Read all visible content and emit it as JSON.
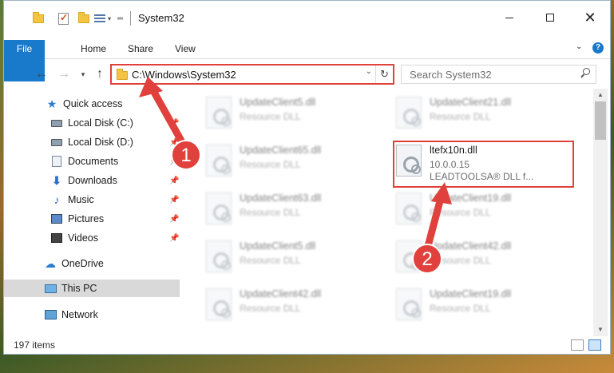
{
  "window": {
    "title": "System32",
    "controls": {
      "minimize_icon": "minimize-icon",
      "maximize_icon": "maximize-icon",
      "close_icon": "close-icon"
    }
  },
  "ribbon": {
    "tabs": [
      {
        "label": "File"
      },
      {
        "label": "Home"
      },
      {
        "label": "Share"
      },
      {
        "label": "View"
      }
    ],
    "accent_color": "#1979ca"
  },
  "navigation": {
    "address": "C:\\Windows\\System32",
    "search_placeholder": "Search System32"
  },
  "sidebar": {
    "items": [
      {
        "label": "Quick access",
        "icon": "star-icon",
        "pinned": false
      },
      {
        "label": "Local Disk (C:)",
        "icon": "disk-icon",
        "pinned": true
      },
      {
        "label": "Local Disk (D:)",
        "icon": "disk-icon",
        "pinned": true
      },
      {
        "label": "Documents",
        "icon": "documents-icon",
        "pinned": true
      },
      {
        "label": "Downloads",
        "icon": "download-icon",
        "pinned": true
      },
      {
        "label": "Music",
        "icon": "music-icon",
        "pinned": true
      },
      {
        "label": "Pictures",
        "icon": "pictures-icon",
        "pinned": true
      },
      {
        "label": "Videos",
        "icon": "videos-icon",
        "pinned": true
      },
      {
        "label": "OneDrive",
        "icon": "cloud-icon",
        "pinned": false
      },
      {
        "label": "This PC",
        "icon": "computer-icon",
        "pinned": false,
        "selected": true
      },
      {
        "label": "Network",
        "icon": "network-icon",
        "pinned": false
      }
    ]
  },
  "files": {
    "left": [
      {
        "name": "UpdateClient5.dll",
        "desc": "Resource DLL"
      },
      {
        "name": "UpdateClient65.dll",
        "desc": "Resource DLL"
      },
      {
        "name": "UpdateClient63.dll",
        "desc": "Resource DLL"
      },
      {
        "name": "UpdateClient5.dll",
        "desc": "Resource DLL"
      },
      {
        "name": "UpdateClient42.dll",
        "desc": "Resource DLL"
      }
    ],
    "right": [
      {
        "name": "UpdateClient21.dll",
        "desc": "Resource DLL"
      },
      {
        "name": "ltefx10n.dll",
        "version": "10.0.0.15",
        "desc": "LEADTOOLSA® DLL f...",
        "highlighted": true
      },
      {
        "name": "UpdateClient19.dll",
        "desc": "Resource DLL"
      },
      {
        "name": "UpdateClient42.dll",
        "desc": "Resource DLL"
      },
      {
        "name": "UpdateClient19.dll",
        "desc": "Resource DLL"
      }
    ]
  },
  "status": {
    "item_count": "197 items"
  },
  "annotations": {
    "badge1": "1",
    "badge2": "2",
    "color": "#e0413c"
  }
}
